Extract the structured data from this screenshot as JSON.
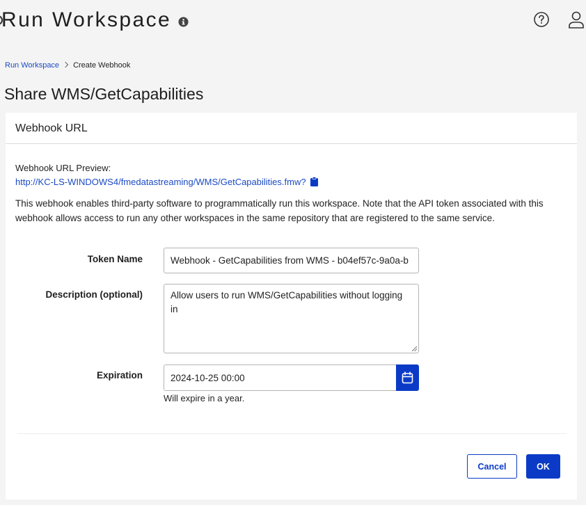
{
  "app": {
    "title": "Run Workspace"
  },
  "breadcrumb": {
    "parent": "Run Workspace",
    "current": "Create Webhook"
  },
  "page": {
    "title": "Share WMS/GetCapabilities"
  },
  "card": {
    "header": "Webhook URL",
    "preview_label": "Webhook URL Preview:",
    "preview_url": "http://KC-LS-WINDOWS4/fmedatastreaming/WMS/GetCapabilities.fmw?",
    "description": "This webhook enables third-party software to programmatically run this workspace. Note that the API token associated with this webhook allows access to run any other workspaces in the same repository that are registered to the same service."
  },
  "form": {
    "token_name_label": "Token Name",
    "token_name_value": "Webhook - GetCapabilities from WMS - b04ef57c-9a0a-b",
    "description_label": "Description (optional)",
    "description_value": "Allow users to run WMS/GetCapabilities without logging in",
    "expiration_label": "Expiration",
    "expiration_value": "2024-10-25 00:00",
    "expiration_helper": "Will expire in a year."
  },
  "actions": {
    "cancel_label": "Cancel",
    "ok_label": "OK"
  },
  "colors": {
    "primary": "#0b3bc6",
    "link": "#1b4ac4",
    "background": "#f4f4f4"
  },
  "icons": {
    "info": "info-icon",
    "help": "help-icon",
    "user": "user-icon",
    "clipboard": "clipboard-icon",
    "calendar": "calendar-icon",
    "breadcrumb_separator": "chevron-right-icon"
  }
}
